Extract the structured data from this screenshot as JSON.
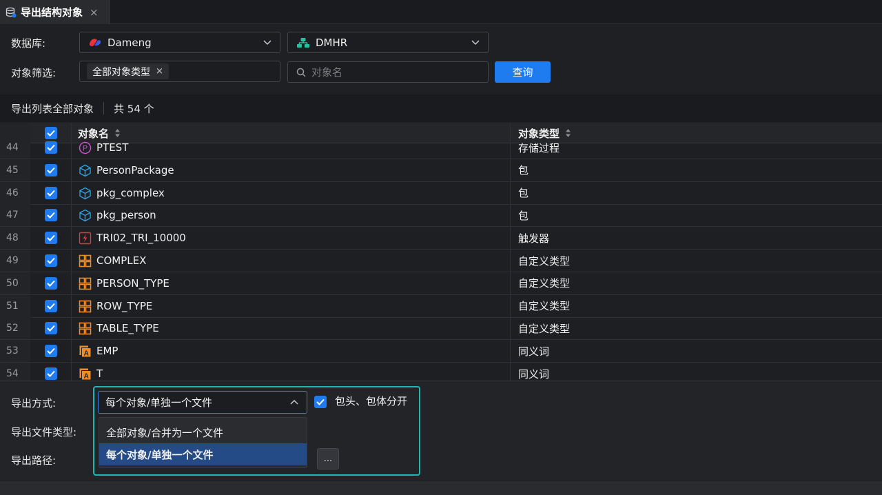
{
  "tab": {
    "title": "导出结构对象",
    "close": "×",
    "icon": "database-icon"
  },
  "form": {
    "database_label": "数据库:",
    "database_value": "Dameng",
    "schema_value": "DMHR",
    "filter_label": "对象筛选:",
    "filter_tag": "全部对象类型",
    "filter_tag_close": "×",
    "search_placeholder": "对象名",
    "query_button": "查询"
  },
  "summary": {
    "scope": "导出列表全部对象",
    "count": "共 54 个"
  },
  "table": {
    "columns": [
      "对象名",
      "对象类型"
    ],
    "rows": [
      {
        "num": "44",
        "name": "PTEST",
        "type": "存储过程",
        "icon": "procedure-icon"
      },
      {
        "num": "45",
        "name": "PersonPackage",
        "type": "包",
        "icon": "package-icon"
      },
      {
        "num": "46",
        "name": "pkg_complex",
        "type": "包",
        "icon": "package-icon"
      },
      {
        "num": "47",
        "name": "pkg_person",
        "type": "包",
        "icon": "package-icon"
      },
      {
        "num": "48",
        "name": "TRI02_TRI_10000",
        "type": "触发器",
        "icon": "trigger-icon"
      },
      {
        "num": "49",
        "name": "COMPLEX",
        "type": "自定义类型",
        "icon": "custom-type-icon"
      },
      {
        "num": "50",
        "name": "PERSON_TYPE",
        "type": "自定义类型",
        "icon": "custom-type-icon"
      },
      {
        "num": "51",
        "name": "ROW_TYPE",
        "type": "自定义类型",
        "icon": "custom-type-icon"
      },
      {
        "num": "52",
        "name": "TABLE_TYPE",
        "type": "自定义类型",
        "icon": "custom-type-icon"
      },
      {
        "num": "53",
        "name": "EMP",
        "type": "同义词",
        "icon": "synonym-icon"
      },
      {
        "num": "54",
        "name": "T",
        "type": "同义词",
        "icon": "synonym-icon"
      }
    ]
  },
  "export": {
    "mode_label": "导出方式:",
    "mode_value": "每个对象/单独一个文件",
    "split_label": "包头、包体分开",
    "filetype_label": "导出文件类型:",
    "path_label": "导出路径:",
    "options": [
      "全部对象/合并为一个文件",
      "每个对象/单独一个文件"
    ],
    "browse": "..."
  },
  "colors": {
    "accent": "#1e7bf0",
    "focus": "#1fb7b0",
    "selected_option": "#254b86"
  }
}
